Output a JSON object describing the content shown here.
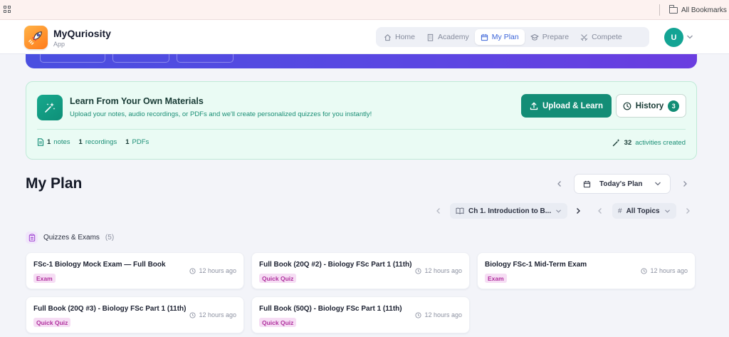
{
  "browser": {
    "bookmarks_label": "All Bookmarks"
  },
  "header": {
    "brand_name": "MyQuriosity",
    "brand_sub": "App",
    "nav": [
      {
        "label": "Home",
        "icon": "home-icon",
        "active": false
      },
      {
        "label": "Academy",
        "icon": "building-icon",
        "active": false
      },
      {
        "label": "My Plan",
        "icon": "calendar-icon",
        "active": true
      },
      {
        "label": "Prepare",
        "icon": "graduation-cap-icon",
        "active": false
      },
      {
        "label": "Compete",
        "icon": "crossed-swords-icon",
        "active": false
      }
    ],
    "avatar_initial": "U",
    "colors": {
      "accent": "#3b64d8",
      "avatar": "#13a494"
    }
  },
  "learn": {
    "title": "Learn From Your Own Materials",
    "description": "Upload your notes, audio recordings, or PDFs and we'll create personalized quizzes for you instantly!",
    "upload_label": "Upload & Learn",
    "history_label": "History",
    "history_count": "3",
    "stats": {
      "notes_count": "1",
      "notes_label": "notes",
      "recordings_count": "1",
      "recordings_label": "recordings",
      "pdfs_count": "1",
      "pdfs_label": "PDFs"
    },
    "activities_count": "32",
    "activities_label": "activities created",
    "colors": {
      "primary": "#138d76",
      "background": "#eafbf4"
    }
  },
  "plan": {
    "title": "My Plan",
    "period_label": "Today's Plan",
    "chapter_filter": "Ch 1. Introduction to B...",
    "topic_filter": "All Topics"
  },
  "section": {
    "label": "Quizzes & Exams",
    "count": "(5)"
  },
  "cards": [
    {
      "title": "FSc-1 Biology Mock Exam — Full Book",
      "tag": "Exam",
      "time": "12 hours ago"
    },
    {
      "title": "Full Book (20Q #2) - Biology FSc Part 1 (11th)",
      "tag": "Quick Quiz",
      "time": "12 hours ago"
    },
    {
      "title": "Biology FSc-1 Mid-Term Exam",
      "tag": "Exam",
      "time": "12 hours ago"
    },
    {
      "title": "Full Book (20Q #3) - Biology FSc Part 1 (11th)",
      "tag": "Quick Quiz",
      "time": "12 hours ago"
    },
    {
      "title": "Full Book (50Q) - Biology FSc Part 1 (11th)",
      "tag": "Quick Quiz",
      "time": "12 hours ago"
    }
  ]
}
